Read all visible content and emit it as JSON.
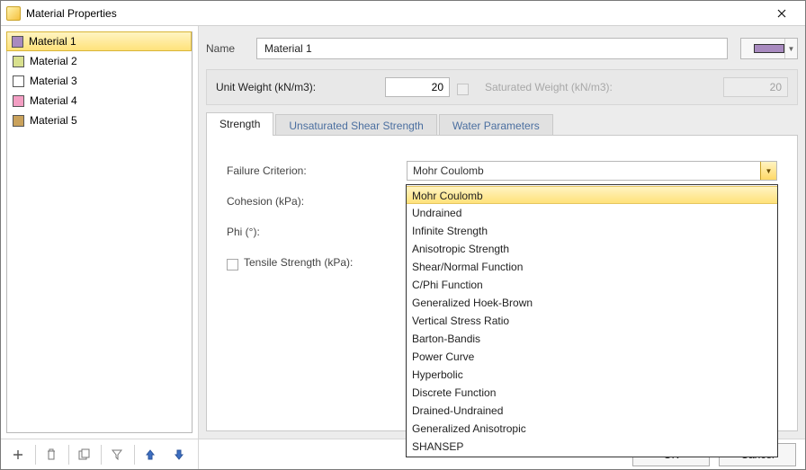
{
  "window": {
    "title": "Material Properties"
  },
  "sidebar": {
    "materials": [
      {
        "label": "Material 1",
        "swatch": "#a88abf",
        "selected": true
      },
      {
        "label": "Material 2",
        "swatch": "#d8e08e",
        "selected": false
      },
      {
        "label": "Material 3",
        "swatch": "#ffffff",
        "selected": false
      },
      {
        "label": "Material 4",
        "swatch": "#f39ec3",
        "selected": false
      },
      {
        "label": "Material 5",
        "swatch": "#caa25c",
        "selected": false
      }
    ]
  },
  "form": {
    "name_label": "Name",
    "name_value": "Material 1",
    "color": "#a88abf",
    "unit_weight_label": "Unit Weight (kN/m3):",
    "unit_weight_value": "20",
    "sat_weight_label": "Saturated Weight (kN/m3):",
    "sat_weight_value": "20"
  },
  "tabs": [
    {
      "label": "Strength",
      "active": true
    },
    {
      "label": "Unsaturated Shear Strength",
      "active": false
    },
    {
      "label": "Water Parameters",
      "active": false
    }
  ],
  "strength": {
    "criterion_label": "Failure Criterion:",
    "criterion_value": "Mohr Coulomb",
    "cohesion_label": "Cohesion (kPa):",
    "phi_label": "Phi (°):",
    "tensile_label": "Tensile Strength (kPa):",
    "criterion_options": [
      "Mohr Coulomb",
      "Undrained",
      "Infinite Strength",
      "Anisotropic Strength",
      "Shear/Normal Function",
      "C/Phi Function",
      "Generalized Hoek-Brown",
      "Vertical Stress Ratio",
      "Barton-Bandis",
      "Power Curve",
      "Hyperbolic",
      "Discrete Function",
      "Drained-Undrained",
      "Generalized Anisotropic",
      "SHANSEP"
    ]
  },
  "buttons": {
    "ok": "OK",
    "cancel": "Cancel"
  }
}
